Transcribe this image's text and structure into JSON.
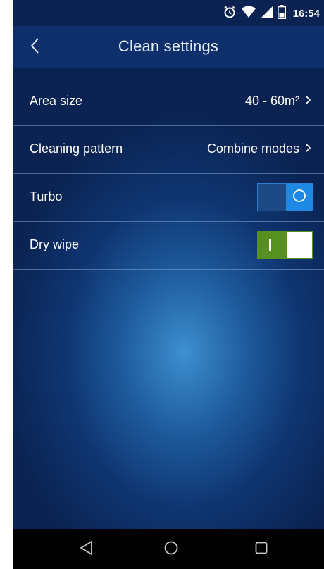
{
  "status_bar": {
    "time": "16:54",
    "icons": [
      "alarm-icon",
      "wifi-icon",
      "signal-icon",
      "battery-icon"
    ]
  },
  "header": {
    "title": "Clean settings",
    "back_icon": "chevron-left-icon"
  },
  "settings": {
    "area_size": {
      "label": "Area size",
      "value": "40 - 60m²"
    },
    "cleaning_pattern": {
      "label": "Cleaning pattern",
      "value": "Combine modes"
    },
    "turbo": {
      "label": "Turbo",
      "enabled": false
    },
    "dry_wipe": {
      "label": "Dry wipe",
      "enabled": true
    }
  },
  "nav_bar": {
    "icons": [
      "back-triangle-icon",
      "home-circle-icon",
      "recents-square-icon"
    ]
  },
  "colors": {
    "header_bg": "#0d2f6c",
    "toggle_off_bg": "#1c4a84",
    "toggle_off_knob": "#1e88e5",
    "toggle_on_bg": "#57901f",
    "text": "#ffffff"
  }
}
